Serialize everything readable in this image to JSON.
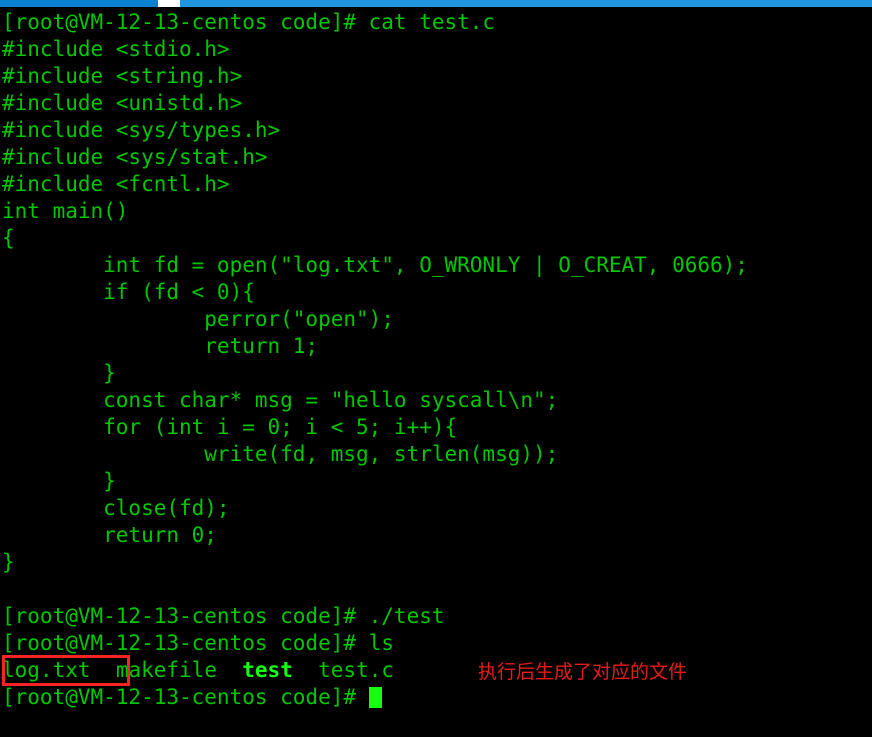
{
  "window": {
    "titlebar": {
      "active_tab_color": "#0c81d4",
      "inactive_color": "#2196de",
      "separator_color": "#ffffff"
    }
  },
  "terminal": {
    "background_color": "#000000",
    "foreground_color": "#00c700",
    "bright_color": "#15ff15",
    "prompt": "[root@VM-12-13-centos code]# ",
    "lines": [
      {
        "id": "l01",
        "text": "[root@VM-12-13-centos code]# cat test.c"
      },
      {
        "id": "l02",
        "text": "#include <stdio.h>"
      },
      {
        "id": "l03",
        "text": "#include <string.h>"
      },
      {
        "id": "l04",
        "text": "#include <unistd.h>"
      },
      {
        "id": "l05",
        "text": "#include <sys/types.h>"
      },
      {
        "id": "l06",
        "text": "#include <sys/stat.h>"
      },
      {
        "id": "l07",
        "text": "#include <fcntl.h>"
      },
      {
        "id": "l08",
        "text": "int main()"
      },
      {
        "id": "l09",
        "text": "{"
      },
      {
        "id": "l10",
        "text": "        int fd = open(\"log.txt\", O_WRONLY | O_CREAT, 0666);"
      },
      {
        "id": "l11",
        "text": "        if (fd < 0){"
      },
      {
        "id": "l12",
        "text": "                perror(\"open\");"
      },
      {
        "id": "l13",
        "text": "                return 1;"
      },
      {
        "id": "l14",
        "text": "        }"
      },
      {
        "id": "l15",
        "text": "        const char* msg = \"hello syscall\\n\";"
      },
      {
        "id": "l16",
        "text": "        for (int i = 0; i < 5; i++){"
      },
      {
        "id": "l17",
        "text": "                write(fd, msg, strlen(msg));"
      },
      {
        "id": "l18",
        "text": "        }"
      },
      {
        "id": "l19",
        "text": "        close(fd);"
      },
      {
        "id": "l20",
        "text": "        return 0;"
      },
      {
        "id": "l21",
        "text": "}"
      },
      {
        "id": "l22",
        "text": ""
      },
      {
        "id": "l23",
        "text": "[root@VM-12-13-centos code]# ./test"
      },
      {
        "id": "l24",
        "text": "[root@VM-12-13-centos code]# ls"
      }
    ],
    "ls_output": {
      "entries": [
        {
          "name": "log.txt",
          "kind": "file",
          "highlighted": true
        },
        {
          "name": "makefile",
          "kind": "file",
          "highlighted": false
        },
        {
          "name": "test",
          "kind": "executable",
          "highlighted": false
        },
        {
          "name": "test.c",
          "kind": "file",
          "highlighted": false
        }
      ],
      "gap_1": "  ",
      "gap_2": "  ",
      "gap_3": "  "
    },
    "final_prompt": "[root@VM-12-13-centos code]# "
  },
  "annotation": {
    "text": "执行后生成了对应的文件",
    "color": "#e81b1b"
  },
  "highlight_box": {
    "color": "#fa2323",
    "target": "log.txt"
  }
}
